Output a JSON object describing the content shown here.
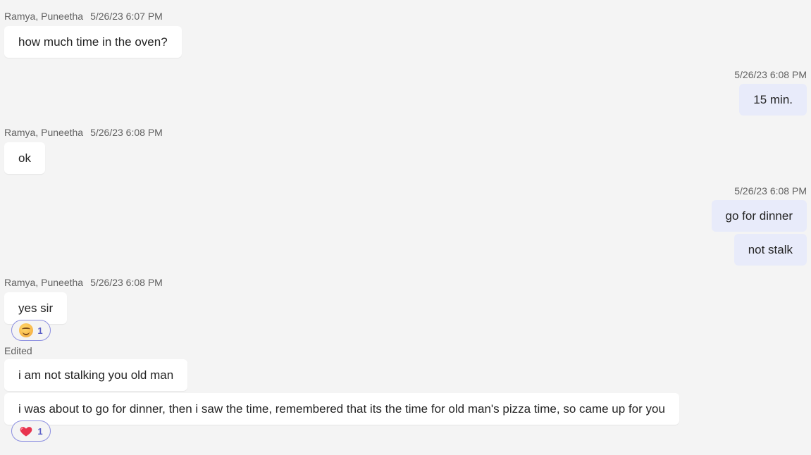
{
  "messages": [
    {
      "sender": "Ramya, Puneetha",
      "timestamp": "5/26/23 6:07 PM",
      "text": "how much time in the oven?"
    },
    {
      "timestamp": "5/26/23 6:08 PM",
      "text": "15 min."
    },
    {
      "sender": "Ramya, Puneetha",
      "timestamp": "5/26/23 6:08 PM",
      "text": "ok"
    },
    {
      "timestamp": "5/26/23 6:08 PM",
      "text": "go for dinner"
    },
    {
      "text": "not stalk"
    },
    {
      "sender": "Ramya, Puneetha",
      "timestamp": "5/26/23 6:08 PM",
      "text": "yes sir",
      "reaction": {
        "icon": "smiling-face-icon",
        "count": "1"
      }
    },
    {
      "edited_label": "Edited",
      "text": "i am not stalking you old man"
    },
    {
      "text": "i was about to go for dinner, then i saw the time, remembered that its the time for old man's pizza time, so came up for you",
      "reaction": {
        "icon": "heart-icon",
        "count": "1"
      }
    }
  ],
  "colors": {
    "background": "#f4f4f4",
    "incoming_bubble": "#ffffff",
    "outgoing_bubble": "#e8ebfa",
    "reaction_border": "#8b8ee0",
    "reaction_count": "#5b5fc7",
    "heart": "#e8344e"
  }
}
